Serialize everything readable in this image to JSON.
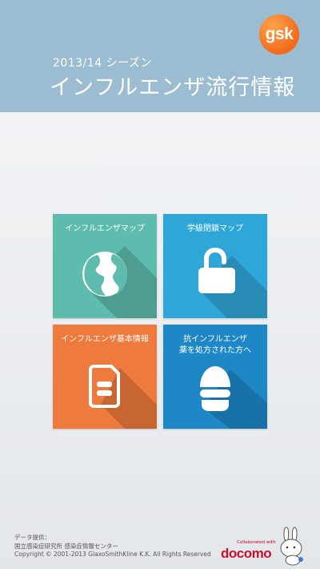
{
  "header": {
    "logo_text": "gsk",
    "season": "2013/14 シーズン",
    "title": "インフルエンザ流行情報"
  },
  "tiles": [
    {
      "label": "インフルエンザマップ",
      "color": "#5dbcae",
      "icon": "globe-icon"
    },
    {
      "label": "学級閉鎖マップ",
      "color": "#2fa6d8",
      "icon": "lock-icon"
    },
    {
      "label": "インフルエンザ基本情報",
      "color": "#ee7a3d",
      "icon": "document-icon"
    },
    {
      "label_line1": "抗インフルエンザ",
      "label_line2": "薬を処方された方へ",
      "color": "#1e88c7",
      "icon": "capsule-icon"
    }
  ],
  "footer": {
    "line1": "データ提供：",
    "line2": "国立感染症研究所 感染症情報センター",
    "copyright": "Copyright © 2001-2013 GlaxoSmithKline K.K. All Rights Reserved"
  },
  "docomo": {
    "collab_text": "Collaborated with",
    "brand": "docomo"
  }
}
